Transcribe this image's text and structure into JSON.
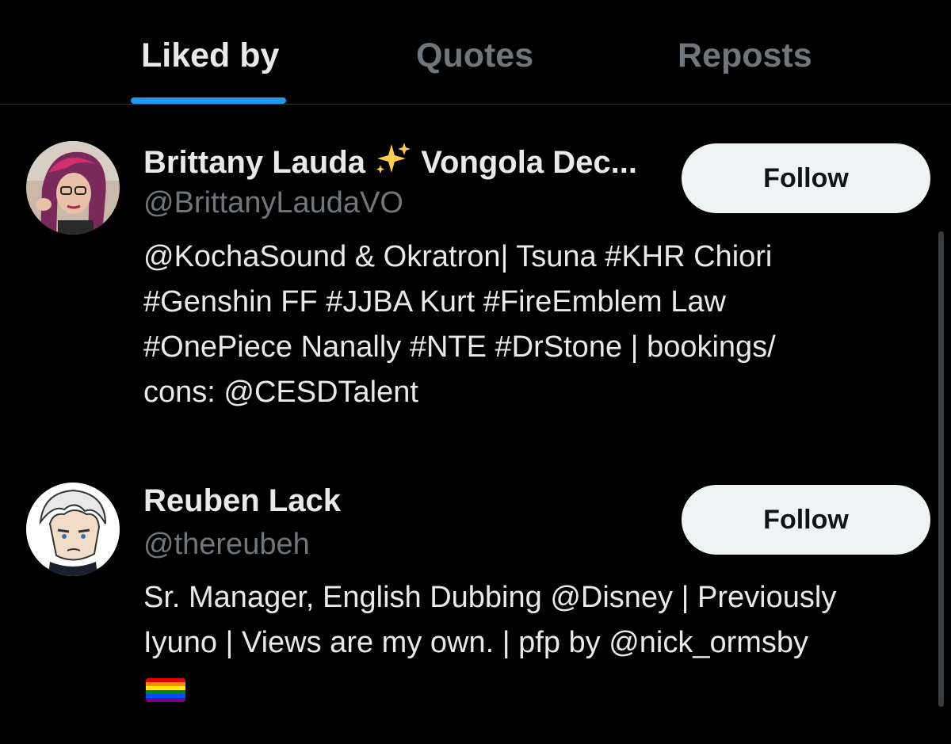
{
  "tabs": [
    {
      "label": "Liked by",
      "active": true
    },
    {
      "label": "Quotes",
      "active": false
    },
    {
      "label": "Reposts",
      "active": false
    }
  ],
  "accent_color": "#1d9bf0",
  "users": [
    {
      "display_name_prefix": "Brittany Lauda",
      "display_name_emoji": "sparkles",
      "display_name_suffix": "Vongola Dec...",
      "handle": "@BrittanyLaudaVO",
      "follow_label": "Follow",
      "bio_lines": [
        "@KochaSound & Okratron| Tsuna #KHR Chiori",
        "#Genshin FF #JJBA Kurt #FireEmblem Law",
        "#OnePiece Nanally #NTE #DrStone | bookings/",
        "cons: @CESDTalent"
      ]
    },
    {
      "display_name": "Reuben Lack",
      "handle": "@thereubeh",
      "follow_label": "Follow",
      "bio_lines": [
        "Sr. Manager, English Dubbing @Disney | Previously",
        "Iyuno | Views are my own. | pfp by @nick_ormsby"
      ],
      "bio_emoji": "rainbow-flag"
    }
  ]
}
